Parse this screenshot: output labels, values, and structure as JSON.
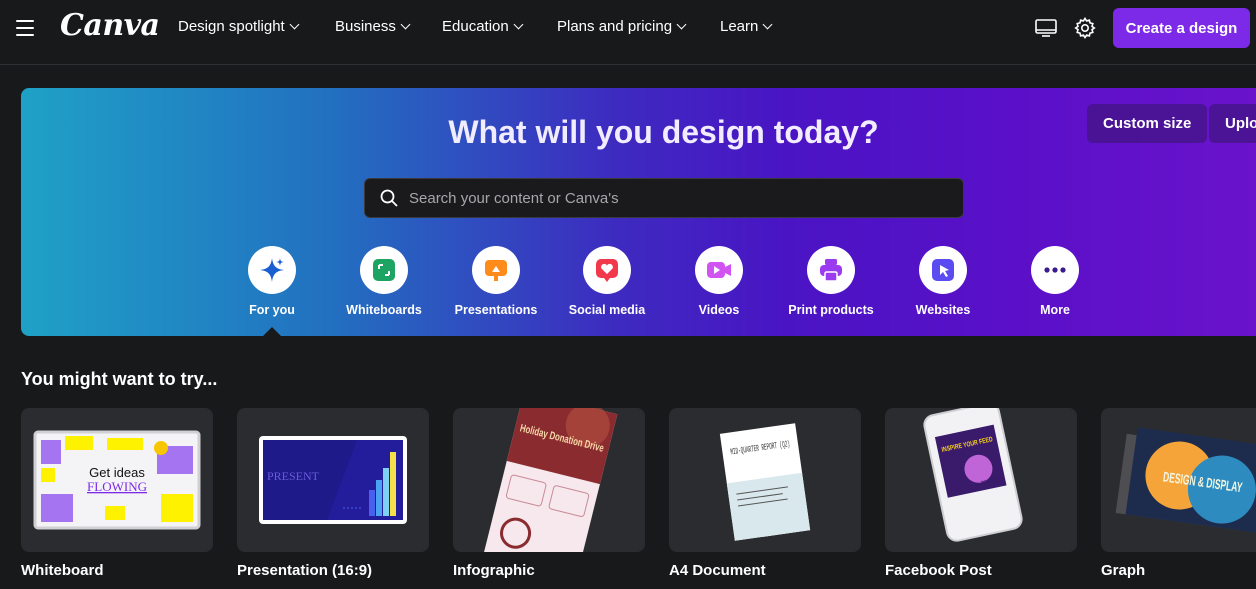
{
  "nav": {
    "logo": "Canva",
    "items": [
      {
        "label": "Design spotlight"
      },
      {
        "label": "Business"
      },
      {
        "label": "Education"
      },
      {
        "label": "Plans and pricing"
      },
      {
        "label": "Learn"
      }
    ],
    "create_label": "Create a design",
    "accent": "#7d2ae8"
  },
  "hero": {
    "title": "What will you design today?",
    "custom_size_label": "Custom size",
    "upload_label": "Uplo",
    "search_placeholder": "Search your content or Canva's",
    "categories": [
      {
        "label": "For you",
        "icon": "sparkle-icon",
        "selected": true
      },
      {
        "label": "Whiteboards",
        "icon": "whiteboard-icon"
      },
      {
        "label": "Presentations",
        "icon": "presentation-icon"
      },
      {
        "label": "Social media",
        "icon": "heart-icon"
      },
      {
        "label": "Videos",
        "icon": "video-icon"
      },
      {
        "label": "Print products",
        "icon": "printer-icon"
      },
      {
        "label": "Websites",
        "icon": "website-cursor-icon"
      },
      {
        "label": "More",
        "icon": "more-dots-icon"
      }
    ]
  },
  "suggestions": {
    "title": "You might want to try...",
    "cards": [
      {
        "label": "Whiteboard",
        "thumb_text_1": "Get ideas",
        "thumb_text_2": "FLOWING"
      },
      {
        "label": "Presentation (16:9)",
        "thumb_text_1": "PRESENT"
      },
      {
        "label": "Infographic",
        "thumb_text_1": "Holiday Donation Drive"
      },
      {
        "label": "A4 Document",
        "thumb_text_1": "MID-QUARTER REPORT (Q2)"
      },
      {
        "label": "Facebook Post",
        "thumb_text_1": "INSPIRE YOUR FEED",
        "thumb_text_2": "20% OFF"
      },
      {
        "label": "Graph",
        "thumb_text_1": "DESIGN & DISPLAY"
      }
    ]
  }
}
